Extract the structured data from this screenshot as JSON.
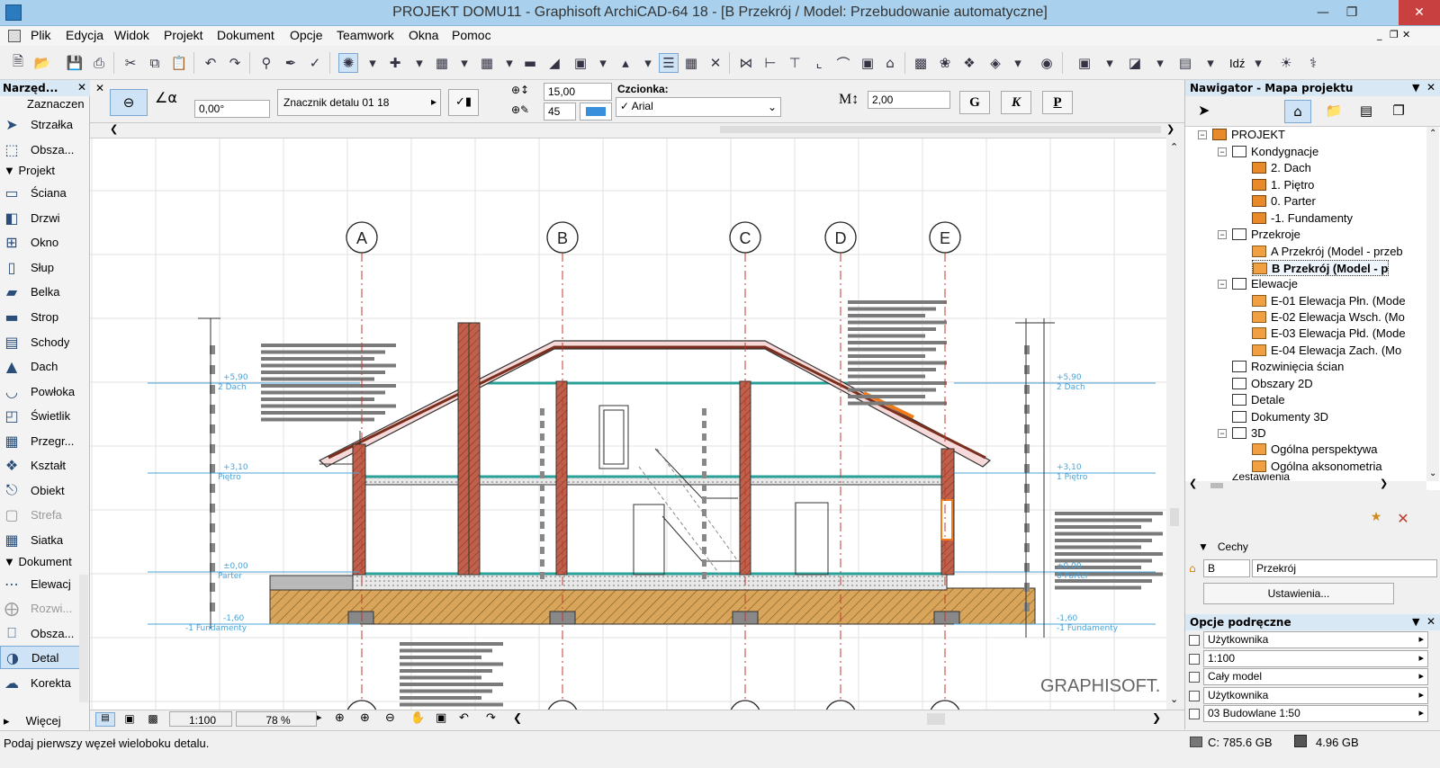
{
  "window": {
    "title": "PROJEKT DOMU11 - Graphisoft ArchiCAD-64 18 - [B Przekrój / Model: Przebudowanie automatyczne]"
  },
  "menu": [
    "Plik",
    "Edycja",
    "Widok",
    "Projekt",
    "Dokument",
    "Opcje",
    "Teamwork",
    "Okna",
    "Pomoc"
  ],
  "toolbar": {
    "go_label": "Idź"
  },
  "toolbox": {
    "title": "Narzęd...",
    "select_label": "Zaznaczen",
    "arrow": "Strzałka",
    "marquee": "Obsza...",
    "section_project": "Projekt",
    "project_tools": [
      "Ściana",
      "Drzwi",
      "Okno",
      "Słup",
      "Belka",
      "Strop",
      "Schody",
      "Dach",
      "Powłoka",
      "Świetlik",
      "Przegr...",
      "Kształt",
      "Obiekt",
      "Strefa",
      "Siatka"
    ],
    "section_document": "Dokument",
    "document_tools": [
      "Elewacj",
      "Rozwi...",
      "Obsza...",
      "Detal",
      "Korekta"
    ],
    "more": "Więcej"
  },
  "infobox": {
    "angle": "0,00°",
    "marker": "Znacznik detalu 01 18",
    "size1": "15,00",
    "size2": "45",
    "font_label": "Czcionka:",
    "font_value": "✓ Arial",
    "m_label": "M",
    "m_value": "2,00",
    "bold": "G",
    "italic": "K",
    "underline": "P"
  },
  "drawing": {
    "axes": [
      "A",
      "B",
      "C",
      "D",
      "E"
    ],
    "levels_left": [
      {
        "elev": "+5,90",
        "name": "2 Dach"
      },
      {
        "elev": "+3,10",
        "name": "Piętro"
      },
      {
        "elev": "±0,00",
        "name": "Parter"
      },
      {
        "elev": "-1,60",
        "name": "-1 Fundamenty"
      }
    ],
    "levels_right": [
      {
        "elev": "+5,90",
        "name": "2 Dach"
      },
      {
        "elev": "+3,10",
        "name": "1 Piętro"
      },
      {
        "elev": "±0,00",
        "name": "0 Parter"
      },
      {
        "elev": "-1,60",
        "name": "-1 Fundamenty"
      }
    ],
    "watermark": "GRAPHISOFT."
  },
  "bottombar": {
    "scale": "1:100",
    "zoom": "78 %"
  },
  "status": {
    "prompt": "Podaj pierwszy węzeł wieloboku detalu.",
    "disk": "C: 785.6 GB",
    "memory": "4.96 GB"
  },
  "navigator": {
    "title": "Nawigator - Mapa projektu",
    "root": "PROJEKT",
    "stories_group": "Kondygnacje",
    "stories": [
      "2. Dach",
      "1. Piętro",
      "0. Parter",
      "-1. Fundamenty"
    ],
    "sections_group": "Przekroje",
    "sections": [
      "A Przekrój (Model - przeb",
      "B Przekrój (Model - p"
    ],
    "elevations_group": "Elewacje",
    "elevations": [
      "E-01 Elewacja Płn. (Mode",
      "E-02 Elewacja Wsch. (Mo",
      "E-03 Elewacja Płd. (Mode",
      "E-04 Elewacja Zach. (Mo"
    ],
    "others": [
      "Rozwinięcia ścian",
      "Obszary 2D",
      "Detale",
      "Dokumenty 3D"
    ],
    "group_3d": "3D",
    "items_3d": [
      "Ogólna perspektywa",
      "Ogólna aksonometria"
    ],
    "cut_item": "Zestawienia"
  },
  "properties": {
    "header": "Cechy",
    "id": "B",
    "name": "Przekrój",
    "settings_button": "Ustawienia..."
  },
  "quick_options": {
    "title": "Opcje podręczne",
    "items": [
      "Użytkownika",
      "1:100",
      "Cały model",
      "Użytkownika",
      "03 Budowlane 1:50"
    ]
  },
  "colors": {
    "title_bar": "#a9d0ec",
    "level_line": "#4aa3d8",
    "axis_line": "#c0392b",
    "wall_brick": "#c0604a",
    "soil": "#d8a55a",
    "slab": "#2aa198"
  }
}
